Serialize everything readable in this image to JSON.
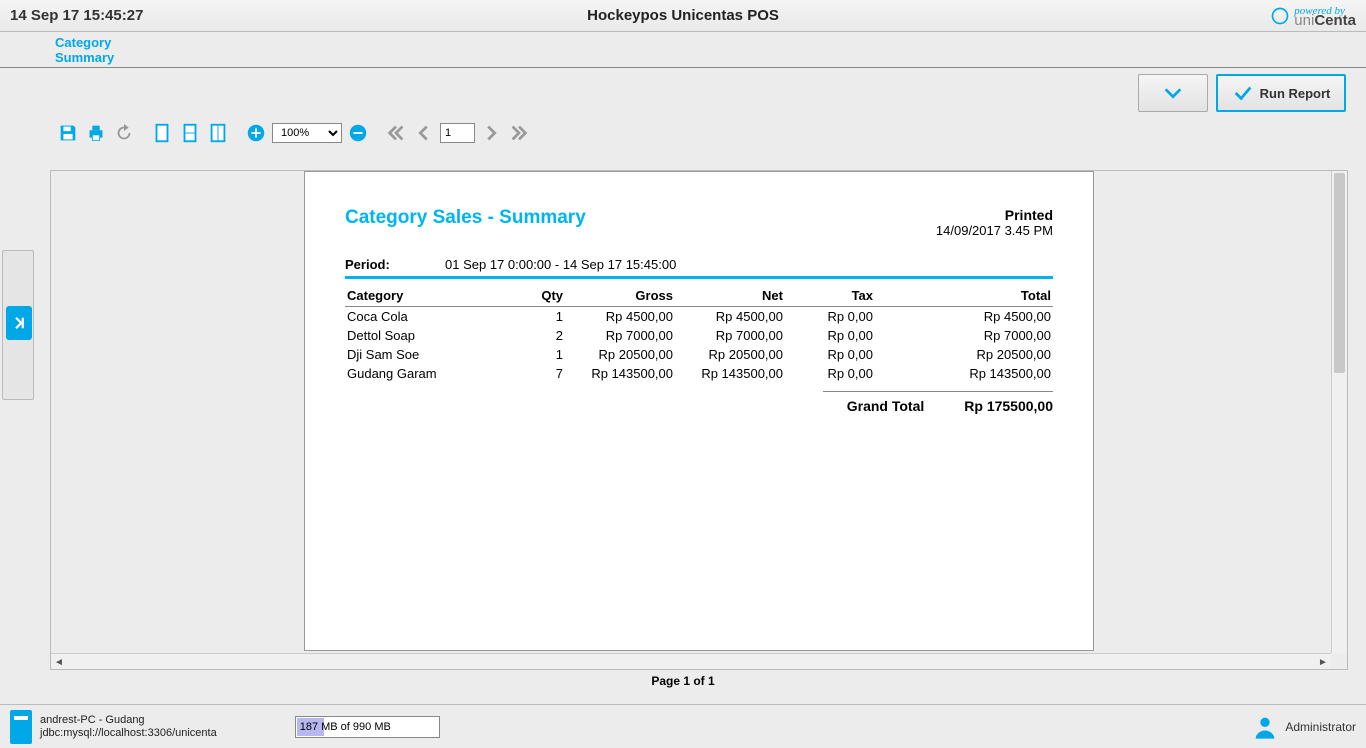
{
  "header": {
    "datetime": "14 Sep 17 15:45:27",
    "title": "Hockeypos Unicentas POS",
    "brand_powered": "powered by",
    "brand_uni": "uni",
    "brand_centa": "Centa"
  },
  "crumbs": {
    "line1": "Category",
    "line2": "Summary"
  },
  "actions": {
    "run_report": "Run Report"
  },
  "toolbar": {
    "zoom": "100%",
    "page_input": "1"
  },
  "report": {
    "title": "Category Sales - Summary",
    "printed_label": "Printed",
    "printed_ts": "14/09/2017 3.45 PM",
    "period_label": "Period:",
    "period_value": "01 Sep 17 0:00:00 - 14 Sep 17 15:45:00",
    "cols": {
      "category": "Category",
      "qty": "Qty",
      "gross": "Gross",
      "net": "Net",
      "tax": "Tax",
      "total": "Total"
    },
    "rows": [
      {
        "category": "Coca Cola",
        "qty": "1",
        "gross": "Rp 4500,00",
        "net": "Rp 4500,00",
        "tax": "Rp 0,00",
        "total": "Rp 4500,00"
      },
      {
        "category": "Dettol Soap",
        "qty": "2",
        "gross": "Rp 7000,00",
        "net": "Rp 7000,00",
        "tax": "Rp 0,00",
        "total": "Rp 7000,00"
      },
      {
        "category": "Dji Sam Soe",
        "qty": "1",
        "gross": "Rp 20500,00",
        "net": "Rp 20500,00",
        "tax": "Rp 0,00",
        "total": "Rp 20500,00"
      },
      {
        "category": "Gudang Garam",
        "qty": "7",
        "gross": "Rp 143500,00",
        "net": "Rp 143500,00",
        "tax": "Rp 0,00",
        "total": "Rp 143500,00"
      }
    ],
    "grand_label": "Grand Total",
    "grand_value": "Rp 175500,00",
    "page_label": "Page 1 of 1"
  },
  "status": {
    "host": "andrest-PC - Gudang",
    "jdbc": "jdbc:mysql://localhost:3306/unicenta",
    "memory": "187 MB of 990 MB",
    "user": "Administrator"
  }
}
